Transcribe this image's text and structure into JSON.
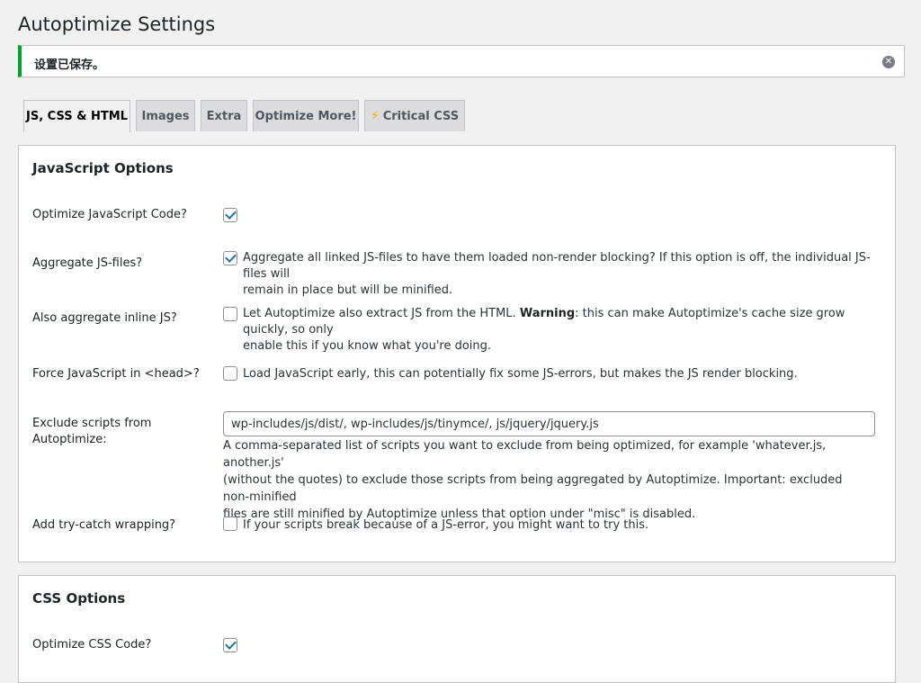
{
  "page": {
    "title": "Autoptimize Settings"
  },
  "notice": {
    "text": "设置已保存。",
    "dismiss_icon": "close-circle-icon"
  },
  "tabs": [
    {
      "label": "JS, CSS & HTML",
      "active": true
    },
    {
      "label": "Images",
      "active": false
    },
    {
      "label": "Extra",
      "active": false
    },
    {
      "label": "Optimize More!",
      "active": false
    },
    {
      "label": "Critical CSS",
      "active": false,
      "icon": "lightning-bolt-icon"
    }
  ],
  "js": {
    "heading": "JavaScript Options",
    "optimize": {
      "label": "Optimize JavaScript Code?",
      "checked": true
    },
    "aggregate": {
      "label": "Aggregate JS-files?",
      "checked": true,
      "desc_line1": "Aggregate all linked JS-files to have them loaded non-render blocking? If this option is off, the individual JS-files will",
      "desc_line2": "remain in place but will be minified."
    },
    "inline": {
      "label": "Also aggregate inline JS?",
      "checked": false,
      "desc_pre": "Let Autoptimize also extract JS from the HTML. ",
      "desc_warning": "Warning",
      "desc_post": ": this can make Autoptimize's cache size grow quickly, so only",
      "desc_line2": "enable this if you know what you're doing."
    },
    "force_head": {
      "label": "Force JavaScript in <head>?",
      "checked": false,
      "desc": "Load JavaScript early, this can potentially fix some JS-errors, but makes the JS render blocking."
    },
    "exclude": {
      "label_line1": "Exclude scripts from",
      "label_line2": "Autoptimize:",
      "value": "wp-includes/js/dist/, wp-includes/js/tinymce/, js/jquery/jquery.js",
      "help_line1": "A comma-separated list of scripts you want to exclude from being optimized, for example 'whatever.js, another.js'",
      "help_line2": "(without the quotes) to exclude those scripts from being aggregated by Autoptimize. Important: excluded non-minified",
      "help_line3": "files are still minified by Autoptimize unless that option under \"misc\" is disabled."
    },
    "trycatch": {
      "label": "Add try-catch wrapping?",
      "checked": false,
      "desc": "If your scripts break because of a JS-error, you might want to try this."
    }
  },
  "css": {
    "heading": "CSS Options",
    "optimize": {
      "label": "Optimize CSS Code?",
      "checked": true
    }
  },
  "colors": {
    "accent": "#2271b1",
    "notice_success": "#00a32a",
    "bolt": "#f0b400"
  }
}
